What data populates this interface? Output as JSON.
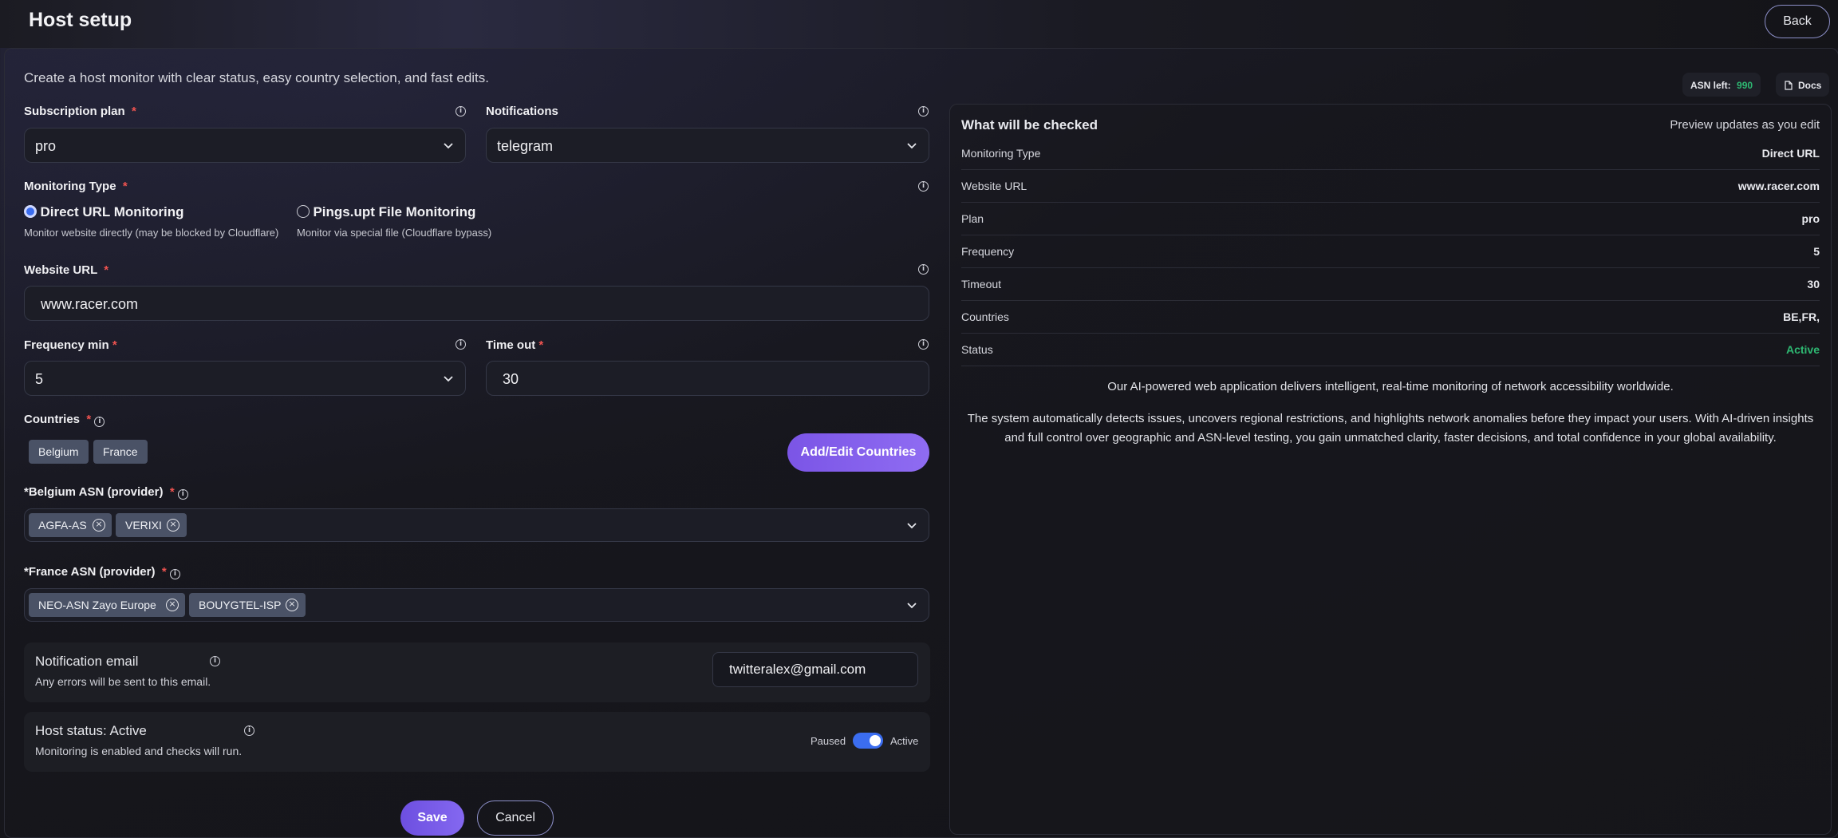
{
  "header": {
    "title": "Host setup",
    "back_label": "Back"
  },
  "intro": "Create a host monitor with clear status, easy country selection, and fast edits.",
  "badges": {
    "asn_left_label": "ASN left:",
    "asn_left_value": "990",
    "docs_label": "Docs"
  },
  "subscription": {
    "label": "Subscription plan",
    "value": "pro"
  },
  "notifications": {
    "label": "Notifications",
    "value": "telegram"
  },
  "monitoring_type": {
    "label": "Monitoring Type",
    "options": [
      {
        "title": "Direct URL Monitoring",
        "desc": "Monitor website directly (may be blocked by Cloudflare)",
        "selected": true
      },
      {
        "title": "Pings.upt File Monitoring",
        "desc": "Monitor via special file (Cloudflare bypass)",
        "selected": false
      }
    ]
  },
  "website": {
    "label": "Website URL",
    "value": "www.racer.com"
  },
  "frequency": {
    "label": "Frequency min",
    "value": "5"
  },
  "timeout": {
    "label": "Time out",
    "value": "30"
  },
  "countries": {
    "label": "Countries",
    "items": [
      "Belgium",
      "France"
    ],
    "add_button": "Add/Edit Countries"
  },
  "belgium_asn": {
    "label": "Belgium ASN (provider)",
    "items": [
      "AGFA-AS",
      "VERIXI"
    ]
  },
  "france_asn": {
    "label": "France ASN (provider)",
    "items": [
      "NEO-ASN Zayo Europe",
      "BOUYGTEL-ISP"
    ]
  },
  "notification_email": {
    "title": "Notification email",
    "desc": "Any errors will be sent to this email.",
    "value": "twitteralex@gmail.com"
  },
  "host_status": {
    "title": "Host status: Active",
    "desc": "Monitoring is enabled and checks will run.",
    "paused_label": "Paused",
    "active_label": "Active",
    "enabled": true
  },
  "actions": {
    "save": "Save",
    "cancel": "Cancel"
  },
  "summary": {
    "title": "What will be checked",
    "hint": "Preview updates as you edit",
    "rows": [
      {
        "key": "Monitoring Type",
        "value": "Direct URL"
      },
      {
        "key": "Website URL",
        "value": "www.racer.com"
      },
      {
        "key": "Plan",
        "value": "pro"
      },
      {
        "key": "Frequency",
        "value": "5"
      },
      {
        "key": "Timeout",
        "value": "30"
      },
      {
        "key": "Countries",
        "value": "BE,FR,"
      },
      {
        "key": "Status",
        "value": "Active"
      }
    ],
    "para1": "Our AI-powered web application delivers intelligent, real-time monitoring of network accessibility worldwide.",
    "para2": "The system automatically detects issues, uncovers regional restrictions, and highlights network anomalies before they impact your users. With AI-driven insights and full control over geographic and ASN-level testing, you gain unmatched clarity, faster decisions, and total confidence in your global availability."
  },
  "colors": {
    "accent": "#7b55e6",
    "active_green": "#2eb872",
    "required_red": "#ef5350",
    "toggle_blue": "#3b6df0"
  }
}
